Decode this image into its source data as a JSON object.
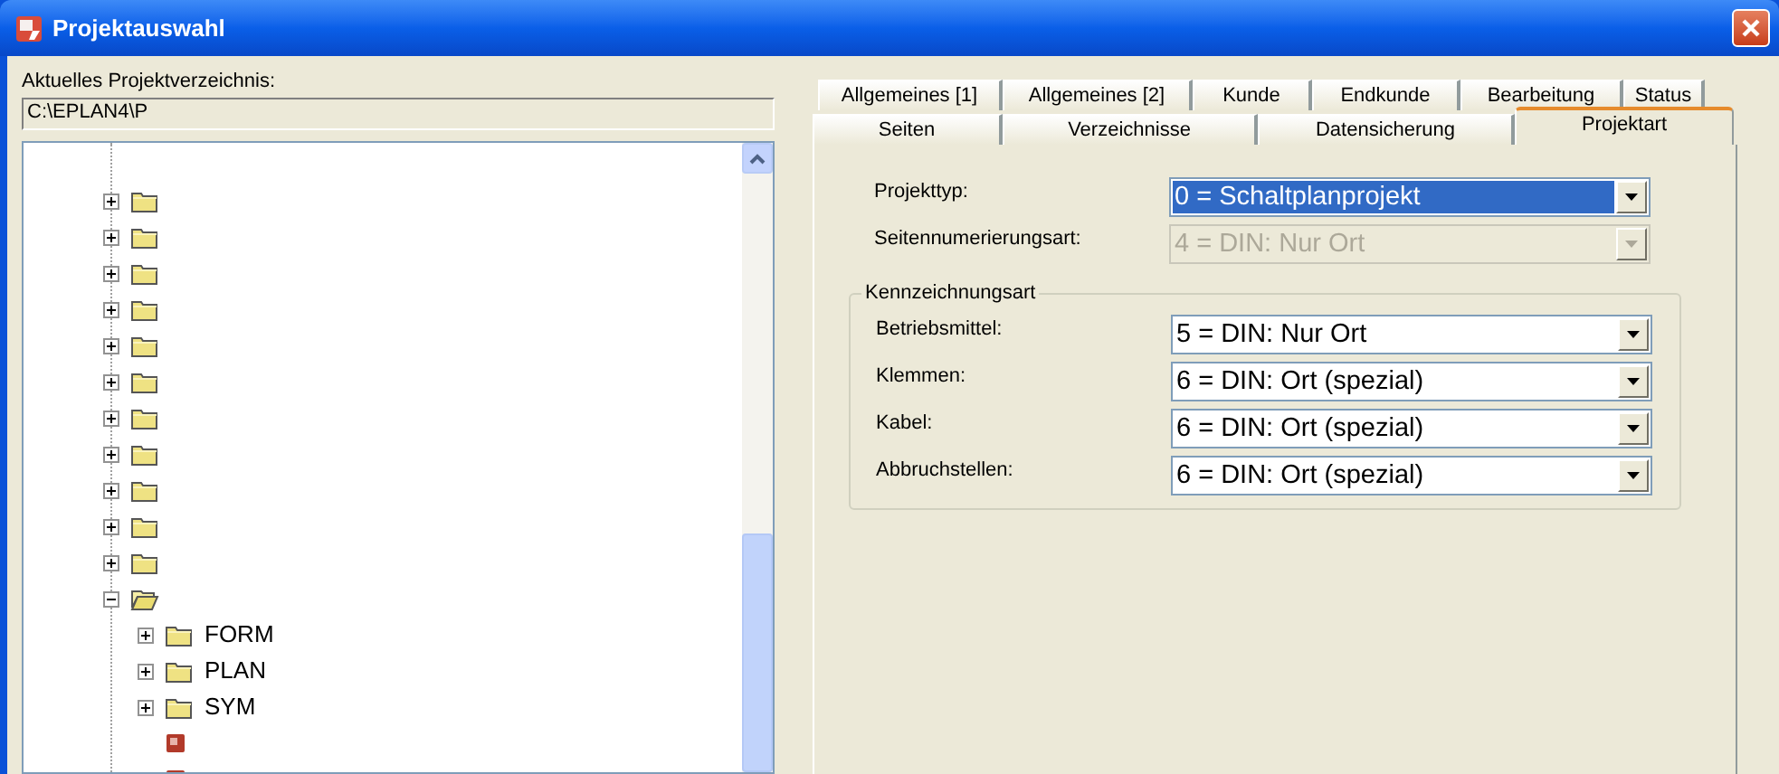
{
  "window": {
    "title": "Projektauswahl"
  },
  "directory": {
    "label": "Aktuelles Projektverzeichnis:",
    "value": "C:\\EPLAN4\\P"
  },
  "tree": [
    {
      "kind": "folder",
      "expanded": false
    },
    {
      "kind": "folder",
      "expanded": false
    },
    {
      "kind": "folder",
      "expanded": false
    },
    {
      "kind": "folder",
      "expanded": false
    },
    {
      "kind": "folder",
      "expanded": false
    },
    {
      "kind": "folder",
      "expanded": false
    },
    {
      "kind": "folder",
      "expanded": false
    },
    {
      "kind": "folder",
      "expanded": false
    },
    {
      "kind": "folder",
      "expanded": false
    },
    {
      "kind": "folder",
      "expanded": false
    },
    {
      "kind": "folder",
      "expanded": false
    },
    {
      "kind": "folder",
      "expanded": true,
      "children": [
        {
          "kind": "folder",
          "label": "FORM",
          "expanded": false
        },
        {
          "kind": "folder",
          "label": "PLAN",
          "expanded": false
        },
        {
          "kind": "folder",
          "label": "SYM",
          "expanded": false
        },
        {
          "kind": "project"
        },
        {
          "kind": "project"
        }
      ]
    }
  ],
  "tab_rows": [
    {
      "tabs": [
        {
          "label": "Allgemeines [1]",
          "selected": false
        },
        {
          "label": "Allgemeines [2]",
          "selected": false
        },
        {
          "label": "Kunde",
          "selected": false
        },
        {
          "label": "Endkunde",
          "selected": false
        },
        {
          "label": "Bearbeitung",
          "selected": false
        },
        {
          "label": "Status",
          "selected": false
        }
      ]
    },
    {
      "tabs": [
        {
          "label": "Seiten",
          "selected": false
        },
        {
          "label": "Verzeichnisse",
          "selected": false
        },
        {
          "label": "Datensicherung",
          "selected": false
        },
        {
          "label": "Projektart",
          "selected": true
        }
      ]
    }
  ],
  "fields": [
    {
      "label": "Projekttyp:",
      "value": "0 = Schaltplanprojekt",
      "focused": true,
      "disabled": false
    },
    {
      "label": "Seitennumerierungsart:",
      "value": "4 = DIN: Nur Ort",
      "focused": false,
      "disabled": true
    }
  ],
  "group": {
    "title": "Kennzeichnungsart",
    "fields": [
      {
        "label": "Betriebsmittel:",
        "value": "5 = DIN: Nur Ort",
        "focused": false,
        "disabled": false
      },
      {
        "label": "Klemmen:",
        "value": "6 = DIN: Ort (spezial)",
        "focused": false,
        "disabled": false
      },
      {
        "label": "Kabel:",
        "value": "6 = DIN: Ort (spezial)",
        "focused": false,
        "disabled": false
      },
      {
        "label": "Abbruchstellen:",
        "value": "6 = DIN: Ort (spezial)",
        "focused": false,
        "disabled": false
      }
    ]
  }
}
